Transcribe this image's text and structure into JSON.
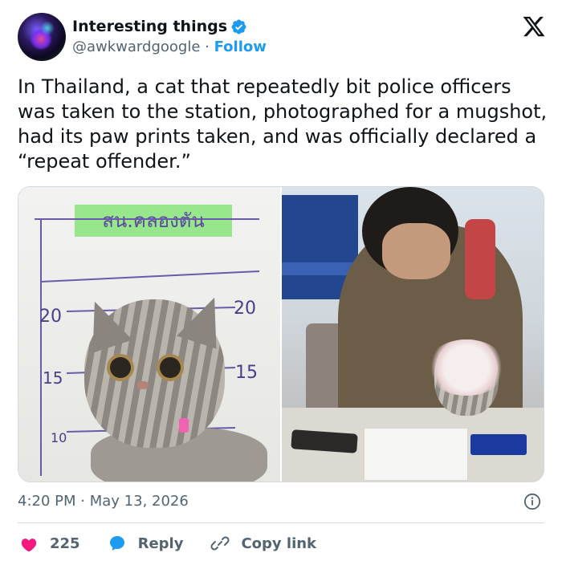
{
  "author": {
    "name": "Interesting things",
    "handle": "@awkwardgoogle",
    "separator": "·",
    "follow_label": "Follow"
  },
  "tweet": {
    "text": "In Thailand, a cat that repeatedly bit police officers was taken to the station, photographed for a mugshot, had its paw prints taken, and was officially declared a “repeat offender.”",
    "time": "4:20 PM",
    "date_separator": "·",
    "date": "May 13, 2026"
  },
  "media": {
    "left_board_heading": "สน.คลองตัน",
    "height_marks": [
      "20",
      "20",
      "15",
      "15",
      "10"
    ]
  },
  "actions": {
    "likes": "225",
    "reply_label": "Reply",
    "copy_link_label": "Copy link"
  },
  "colors": {
    "accent": "#1d9bf0",
    "like": "#f91880",
    "text_secondary": "#536471"
  },
  "icons": [
    "verified-badge-icon",
    "x-logo-icon",
    "info-icon",
    "heart-icon",
    "reply-bubble-icon",
    "link-icon"
  ]
}
